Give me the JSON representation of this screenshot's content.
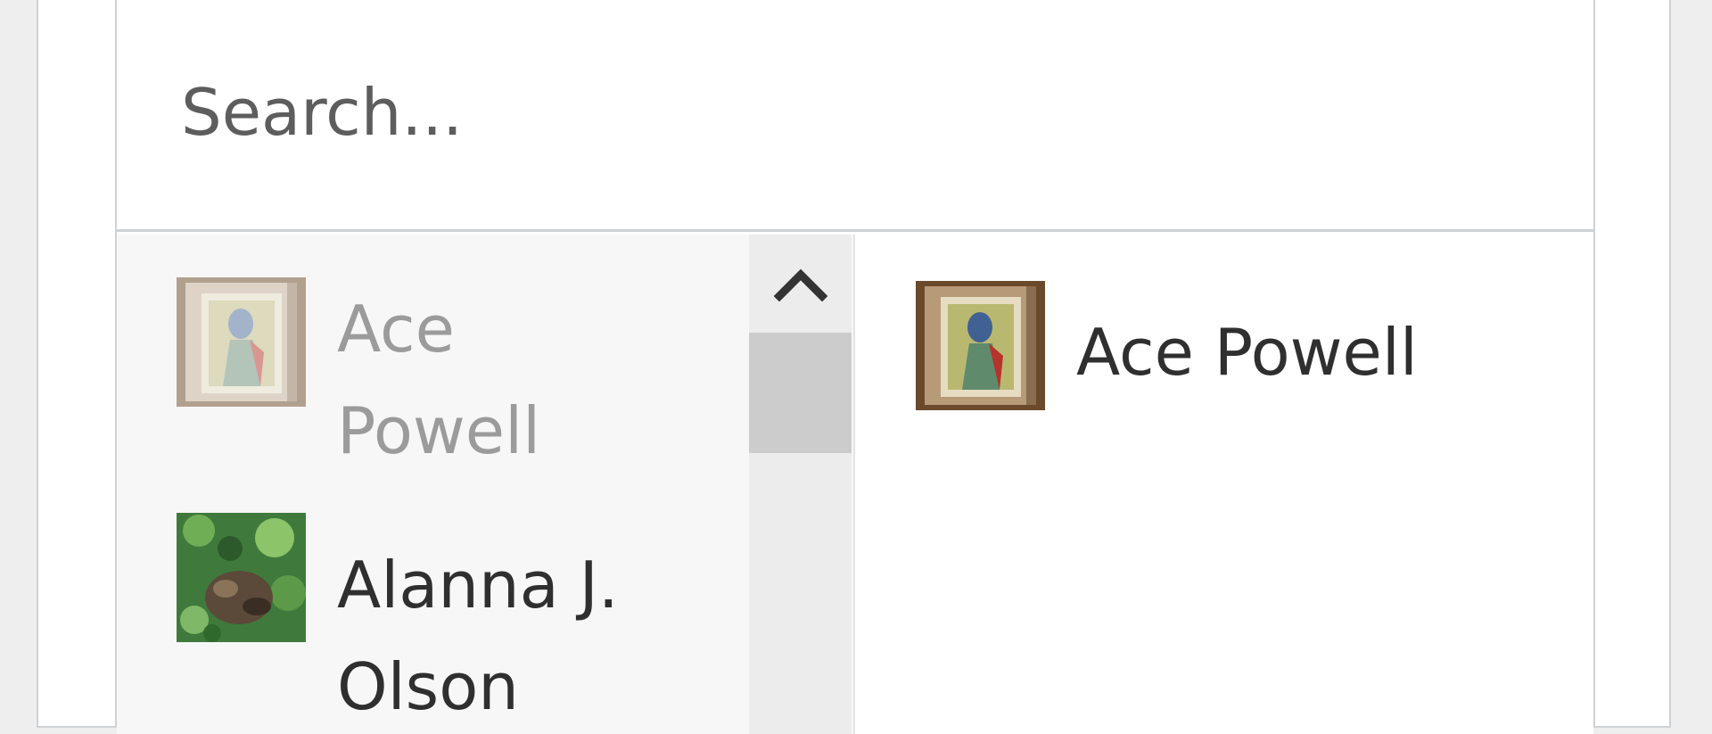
{
  "search": {
    "placeholder": "Search..."
  },
  "available": [
    {
      "name": "Ace Powell",
      "state": "selected",
      "thumbnail": "framed-portrait"
    },
    {
      "name": "Alanna J. Olson",
      "state": "normal",
      "thumbnail": "green-foliage"
    }
  ],
  "chosen": [
    {
      "name": "Ace Powell",
      "thumbnail": "framed-portrait"
    }
  ],
  "scrollbar": {
    "up_icon": "chevron-up-icon"
  },
  "colors": {
    "background": "#eeeeee",
    "panel": "#ffffff",
    "border": "#cfd2d5",
    "list_background": "#f7f7f7",
    "scroll_track": "#ececec",
    "scroll_thumb": "#cccccc",
    "text": "#2f2f2f",
    "muted_text": "#9b9b9b"
  }
}
